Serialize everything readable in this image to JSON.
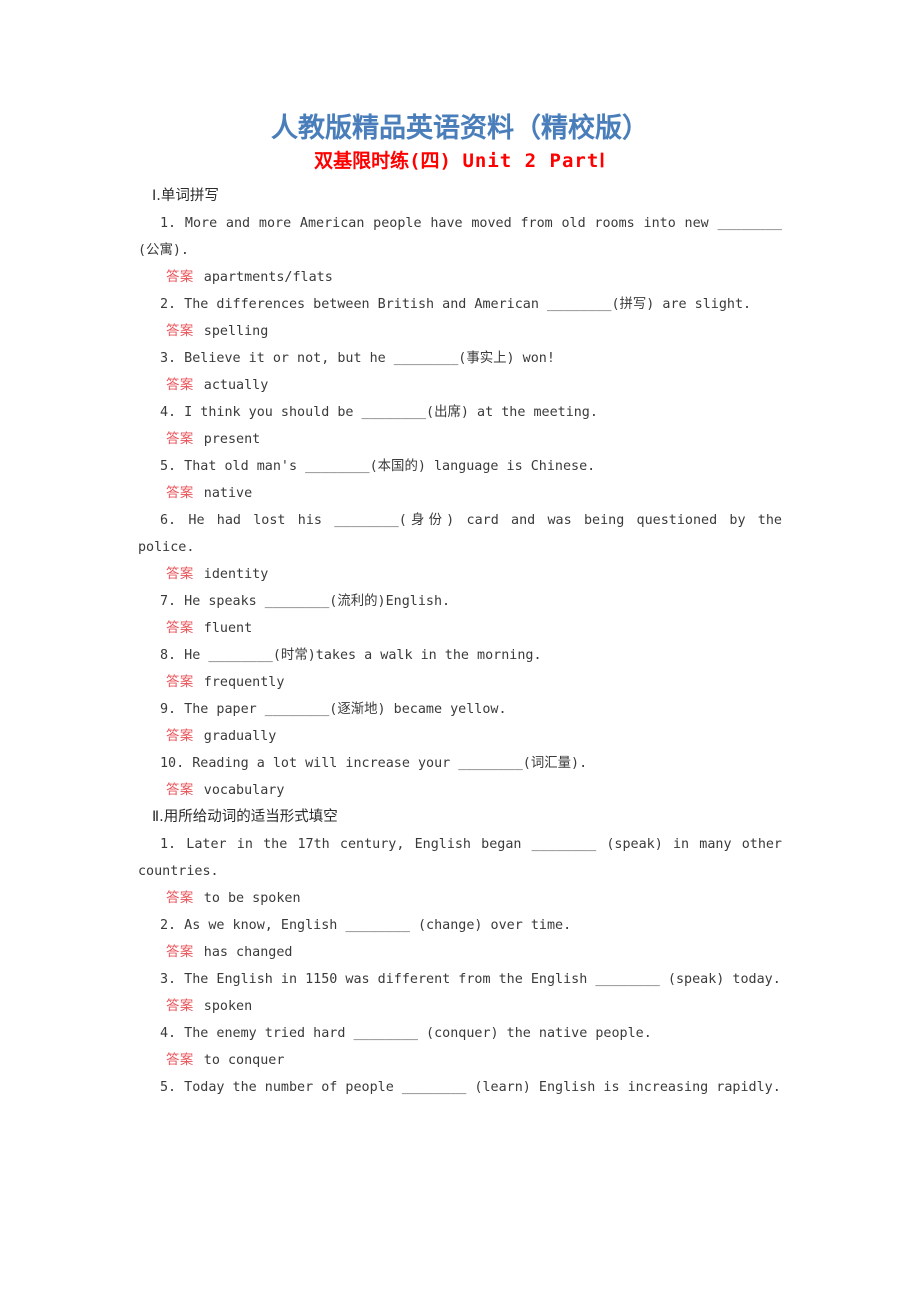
{
  "header": {
    "title": "人教版精品英语资料（精校版）",
    "subtitle_cn": "双基限时练(四)",
    "subtitle_en": "Unit 2  PartⅠ"
  },
  "answer_label": "答案",
  "blank": "________",
  "sections": [
    {
      "heading": "Ⅰ.单词拼写",
      "items": [
        {
          "number": "1.",
          "text": "More and more American people have moved from old rooms into new ________ (公寓).",
          "multiline": true,
          "answer": "apartments/flats"
        },
        {
          "number": "2.",
          "text": "The differences between British and American ________(拼写) are slight.",
          "multiline": false,
          "answer": "spelling"
        },
        {
          "number": "3.",
          "text": "Believe it or not, but he ________(事实上) won!",
          "multiline": false,
          "answer": "actually"
        },
        {
          "number": "4.",
          "text": "I think you should be ________(出席) at the meeting.",
          "multiline": false,
          "answer": "present"
        },
        {
          "number": "5.",
          "text": "That old man's ________(本国的) language is Chinese.",
          "multiline": false,
          "answer": "native"
        },
        {
          "number": "6.",
          "text": "He had lost his ________(身份) card and was being questioned by the police.",
          "multiline": true,
          "answer": "identity"
        },
        {
          "number": "7.",
          "text": "He speaks ________(流利的)English.",
          "multiline": false,
          "answer": "fluent"
        },
        {
          "number": "8.",
          "text": "He ________(时常)takes a walk in the morning.",
          "multiline": false,
          "answer": "frequently"
        },
        {
          "number": "9.",
          "text": "The paper ________(逐渐地) became yellow.",
          "multiline": false,
          "answer": "gradually"
        },
        {
          "number": "10.",
          "text": "Reading a lot will increase your ________(词汇量).",
          "multiline": false,
          "answer": "vocabulary"
        }
      ]
    },
    {
      "heading": "Ⅱ.用所给动词的适当形式填空",
      "items": [
        {
          "number": "1.",
          "text": "Later in the 17th century, English began ________ (speak) in many other countries.",
          "multiline": true,
          "answer": "to be spoken"
        },
        {
          "number": "2.",
          "text": "As we know, English ________ (change) over time.",
          "multiline": false,
          "answer": "has changed"
        },
        {
          "number": "3.",
          "text": "The English in 1150 was different from the English ________ (speak) today.",
          "multiline": true,
          "answer": "spoken"
        },
        {
          "number": "4.",
          "text": "The enemy tried hard ________ (conquer) the native people.",
          "multiline": false,
          "answer": "to conquer"
        },
        {
          "number": "5.",
          "text": "Today the number of people ________ (learn) English is increasing rapidly.",
          "multiline": true,
          "answer": ""
        }
      ]
    }
  ],
  "colors": {
    "title_blue": "#4a7ebb",
    "subtitle_red": "#ff0000",
    "answer_red": "#e8555a",
    "body_text": "#3a3a3a"
  }
}
